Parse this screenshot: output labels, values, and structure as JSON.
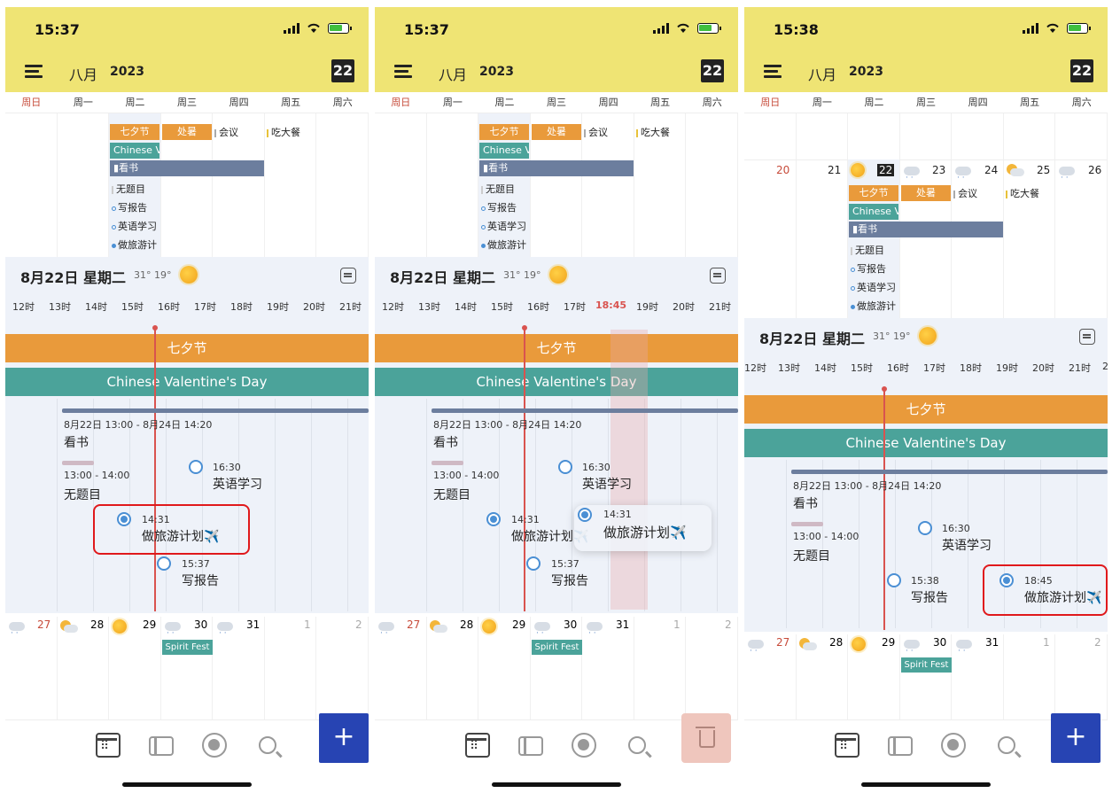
{
  "status": {
    "time1": "15:37",
    "time2": "15:37",
    "time3": "15:38"
  },
  "header": {
    "month": "八月",
    "year": "2023",
    "today": "22"
  },
  "weekdays": [
    "周日",
    "周一",
    "周二",
    "周三",
    "周四",
    "周五",
    "周六"
  ],
  "month_events": {
    "qixi": "七夕节",
    "chushu": "处暑",
    "meeting": "会议",
    "dinner": "吃大餐",
    "valentine_short": "Chinese V",
    "reading": "看书",
    "untitled": "无题目",
    "report": "写报告",
    "english": "英语学习",
    "travel": "做旅游计"
  },
  "day_view": {
    "title": "8月22日 星期二",
    "temps": "31° 19°",
    "hours": [
      "12时",
      "13时",
      "14时",
      "15时",
      "16时",
      "17时",
      "18时",
      "19时",
      "20时",
      "21时"
    ],
    "hours_screen2": [
      "12时",
      "13时",
      "14时",
      "15时",
      "16时",
      "17时",
      "18:45",
      "19时",
      "20时",
      "21时"
    ],
    "hours_screen3": [
      "12时",
      "13时",
      "14时",
      "15时",
      "16时",
      "17时",
      "18时",
      "19时",
      "20时",
      "21时",
      "2"
    ],
    "banner_qixi": "七夕节",
    "banner_valentine": "Chinese Valentine's Day",
    "reading_range": "8月22日 13:00 - 8月24日 14:20",
    "reading_title": "看书",
    "untitled_time": "13:00 - 14:00",
    "untitled_title": "无题目",
    "english_time": "16:30",
    "english_title": "英语学习",
    "travel_time": "14:31",
    "travel_title": "做旅游计划✈️",
    "travel_time_moved": "18:45",
    "report_time": "15:37",
    "report_time3": "15:38",
    "report_title": "写报告"
  },
  "screen3_week": {
    "d20": "20",
    "d21": "21",
    "d22": "22",
    "d23": "23",
    "d24": "24",
    "d25": "25",
    "d26": "26"
  },
  "next_week": {
    "d27": "27",
    "d28": "28",
    "d29": "29",
    "d30": "30",
    "d31": "31",
    "d1": "1",
    "d2": "2",
    "event": "Spirit Fest"
  },
  "fab_label": "+"
}
